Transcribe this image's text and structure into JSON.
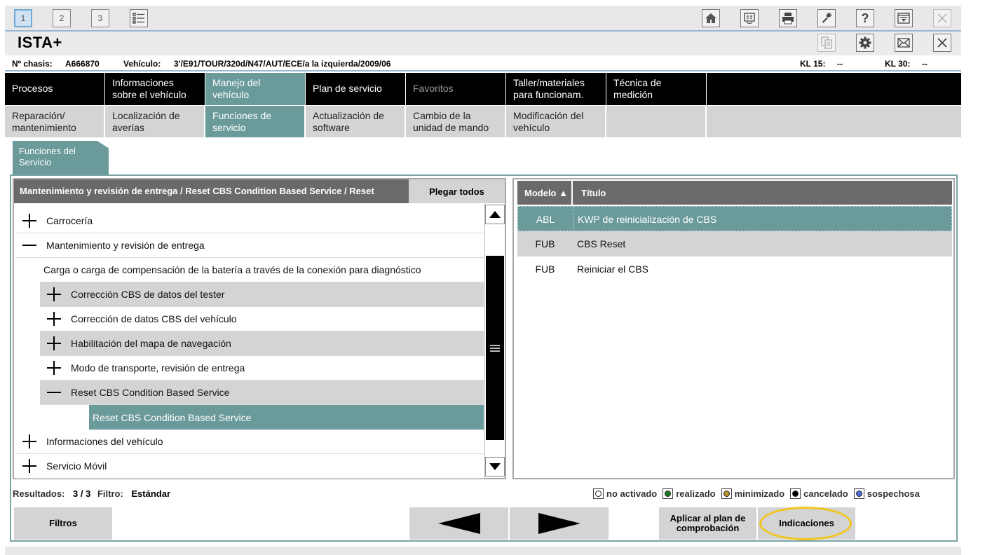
{
  "toolbar": {
    "tabs": [
      "1",
      "2",
      "3"
    ],
    "icons": [
      "list-icon",
      "home-icon",
      "network-icon",
      "printer-icon",
      "wrench-icon",
      "help-icon",
      "window-icon",
      "close-icon"
    ]
  },
  "app": {
    "title": "ISTA+",
    "icons": [
      "document-icon",
      "gear-icon",
      "mail-icon",
      "close-icon"
    ]
  },
  "vehicle": {
    "chassis_label": "Nº chasis:",
    "chassis_value": "A666870",
    "vehicle_label": "Vehículo:",
    "vehicle_value": "3'/E91/TOUR/320d/N47/AUT/ECE/a la izquierda/2009/06",
    "kl15_label": "KL 15:",
    "kl15_value": "--",
    "kl30_label": "KL 30:",
    "kl30_value": "--"
  },
  "nav_main": [
    {
      "label": "Procesos"
    },
    {
      "label": "Informaciones sobre el vehículo"
    },
    {
      "label": "Manejo del vehículo",
      "selected": true
    },
    {
      "label": "Plan de servicio"
    },
    {
      "label": "Favoritos",
      "disabled": true
    },
    {
      "label": "Taller/materiales para funcionam."
    },
    {
      "label": "Técnica de medición"
    }
  ],
  "nav_sub": [
    {
      "label": "Reparación/ mantenimiento"
    },
    {
      "label": "Localización de averías"
    },
    {
      "label": "Funciones de servicio",
      "selected": true
    },
    {
      "label": "Actualización de software"
    },
    {
      "label": "Cambio de la unidad de mando"
    },
    {
      "label": "Modificación del vehículo"
    }
  ],
  "subtab": "Funciones del Servicio",
  "tree_panel": {
    "breadcrumb": "Mantenimiento y revisión de entrega / Reset CBS Condition Based Service / Reset",
    "collapse_label": "Plegar todos",
    "rows": [
      {
        "label": "Carrocería",
        "level": 0,
        "expander": "plus"
      },
      {
        "label": "Mantenimiento y revisión de entrega",
        "level": 0,
        "expander": "minus"
      },
      {
        "label": "Carga o carga de compensación de la batería a través de la conexión para diagnóstico",
        "level": 1,
        "expander": "none"
      },
      {
        "label": "Corrección CBS de datos del tester",
        "level": 1,
        "expander": "plus",
        "shade": "gray"
      },
      {
        "label": "Corrección de datos CBS del vehículo",
        "level": 1,
        "expander": "plus"
      },
      {
        "label": "Habilitación del mapa de navegación",
        "level": 1,
        "expander": "plus",
        "shade": "gray"
      },
      {
        "label": "Modo de transporte, revisión de entrega",
        "level": 1,
        "expander": "plus"
      },
      {
        "label": "Reset CBS Condition Based Service",
        "level": 1,
        "expander": "minus",
        "shade": "gray"
      },
      {
        "label": "Reset CBS Condition Based Service",
        "level": 2,
        "expander": "none",
        "shade": "selected"
      },
      {
        "label": "Informaciones del vehículo",
        "level": 0,
        "expander": "plus"
      },
      {
        "label": "Servicio Móvil",
        "level": 0,
        "expander": "plus"
      }
    ]
  },
  "results_table": {
    "col_model": "Modelo ▲",
    "col_title": "Título",
    "rows": [
      {
        "model": "ABL",
        "title": "KWP de reinicialización de CBS",
        "shade": "selected"
      },
      {
        "model": "FUB",
        "title": "CBS Reset",
        "shade": "gray"
      },
      {
        "model": "FUB",
        "title": "Reiniciar el CBS",
        "shade": "white"
      }
    ]
  },
  "status": {
    "results_label": "Resultados:",
    "results_value": "3 / 3",
    "filter_label": "Filtro:",
    "filter_value": "Estándar"
  },
  "legend": [
    {
      "label": "no activado",
      "color": "#ffffff"
    },
    {
      "label": "realizado",
      "color": "#1e7a1e"
    },
    {
      "label": "minimizado",
      "color": "#b8962a"
    },
    {
      "label": "cancelado",
      "color": "#000000"
    },
    {
      "label": "sospechosa",
      "color": "#4a6fd8"
    }
  ],
  "buttons": {
    "filters": "Filtros",
    "apply": "Aplicar al plan de comprobación",
    "indications": "Indicaciones"
  },
  "colors": {
    "accent": "#6a9a9a",
    "gray_row": "#d4d4d4",
    "header": "#6a6a6a",
    "highlight": "#f2c51c"
  }
}
